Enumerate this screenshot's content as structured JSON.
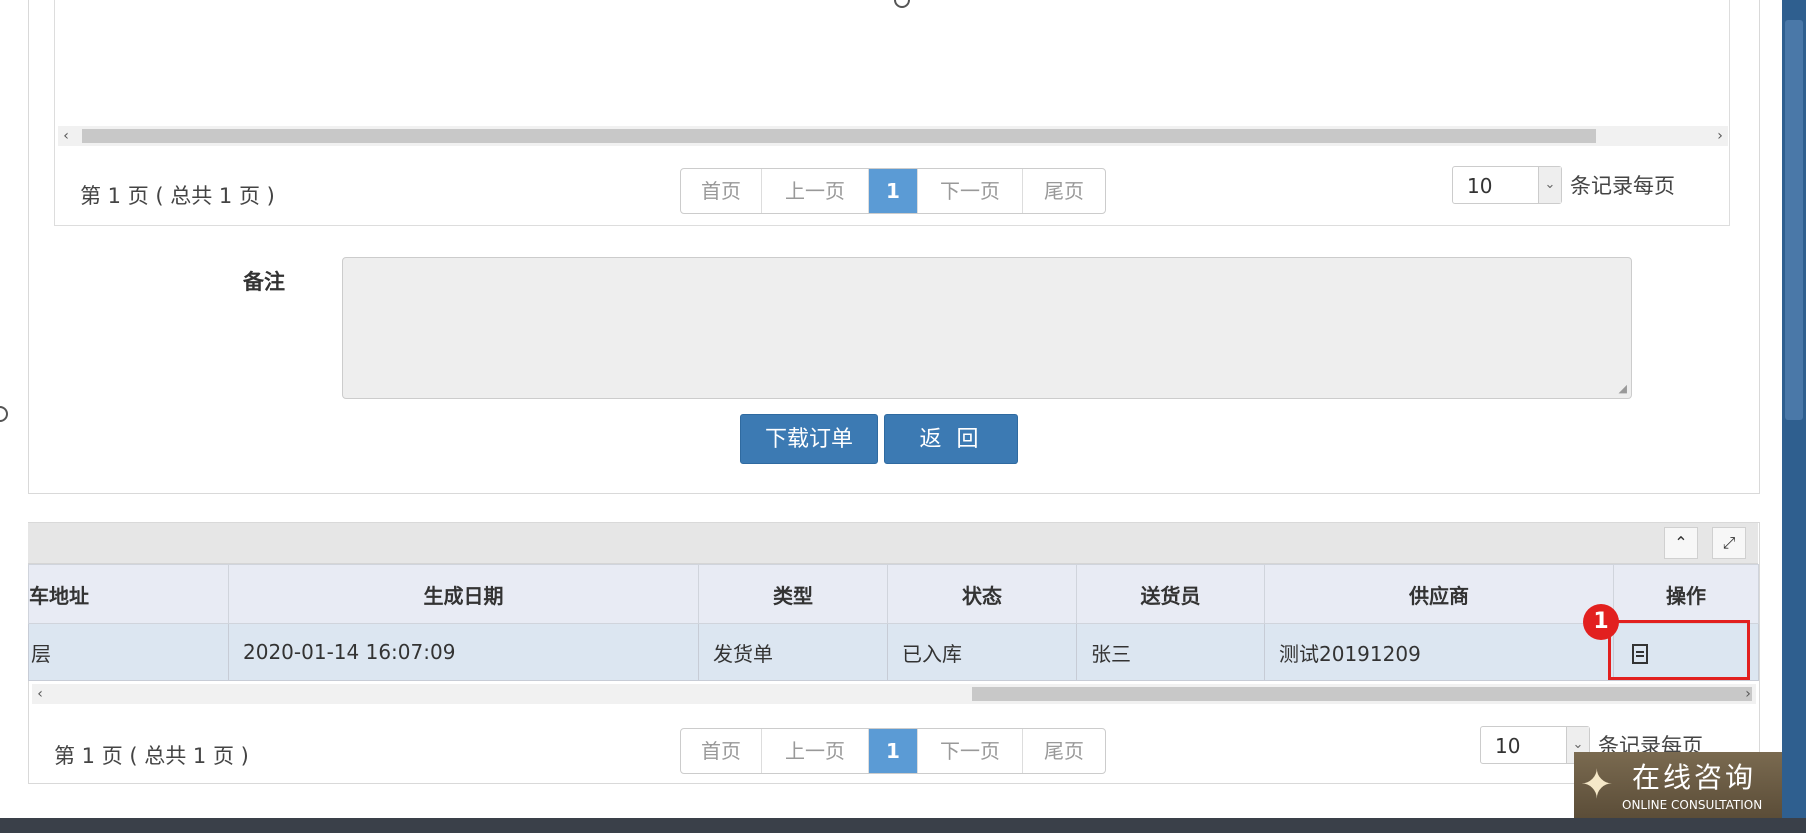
{
  "pager_top": {
    "info": "第 1 页 ( 总共 1 页 )",
    "first": "首页",
    "prev": "上一页",
    "current": "1",
    "next": "下一页",
    "last": "尾页",
    "per_page_value": "10",
    "per_page_label": "条记录每页"
  },
  "remark": {
    "label": "备注",
    "value": ""
  },
  "buttons": {
    "download": "下载订单",
    "back": "返 回"
  },
  "grid": {
    "columns": [
      "车地址",
      "生成日期",
      "类型",
      "状态",
      "送货员",
      "供应商",
      "操作"
    ],
    "rows": [
      {
        "address": "层",
        "date": "2020-01-14 16:07:09",
        "type": "发货单",
        "status": "已入库",
        "courier": "张三",
        "supplier": "测试20191209",
        "action_icon": "document-icon"
      }
    ]
  },
  "pager_bottom": {
    "info": "第 1 页 ( 总共 1 页 )",
    "first": "首页",
    "prev": "上一页",
    "current": "1",
    "next": "下一页",
    "last": "尾页",
    "per_page_value": "10",
    "per_page_label": "条记录每页"
  },
  "annotation": {
    "badge": "1"
  },
  "consult": {
    "title": "在线咨询",
    "subtitle": "ONLINE CONSULTATION"
  },
  "colors": {
    "accent": "#3c7ab3",
    "active_page": "#5b9bd5",
    "highlight": "#e2201f"
  }
}
